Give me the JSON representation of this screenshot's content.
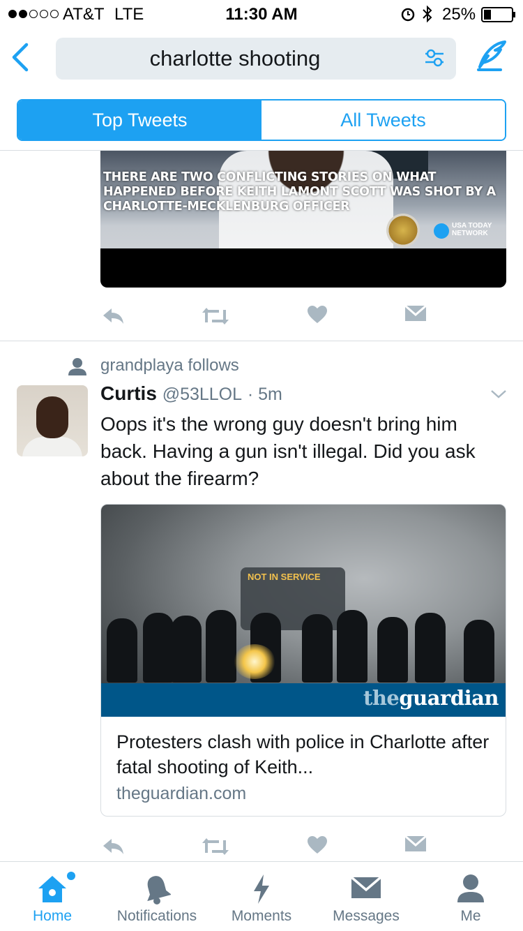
{
  "status_bar": {
    "carrier": "AT&T",
    "network": "LTE",
    "time": "11:30 AM",
    "battery": "25%"
  },
  "search": {
    "query": "charlotte shooting"
  },
  "tabs": [
    {
      "label": "Top Tweets",
      "active": true
    },
    {
      "label": "All Tweets",
      "active": false
    }
  ],
  "previous_tweet": {
    "video_caption": "THERE ARE TWO CONFLICTING STORIES ON WHAT HAPPENED BEFORE KEITH LAMONT SCOTT WAS SHOT BY A CHARLOTTE-MECKLENBURG OFFICER",
    "video_source": "USA TODAY NETWORK"
  },
  "tweet": {
    "social_context": "grandplaya follows",
    "display_name": "Curtis",
    "handle": "@53LLOL",
    "time": "· 5m",
    "text": "Oops it's the wrong guy doesn't bring him back. Having a gun isn't illegal. Did you ask about the firearm?",
    "card": {
      "image_sign": "NOT IN SERVICE",
      "logo_the": "the",
      "logo_guardian": "guardian",
      "title": "Protesters clash with police in Charlotte after fatal shooting of Keith...",
      "domain": "theguardian.com"
    }
  },
  "tab_bar": [
    {
      "label": "Home",
      "icon": "home-icon",
      "active": true
    },
    {
      "label": "Notifications",
      "icon": "bell-icon",
      "active": false
    },
    {
      "label": "Moments",
      "icon": "lightning-icon",
      "active": false
    },
    {
      "label": "Messages",
      "icon": "envelope-icon",
      "active": false
    },
    {
      "label": "Me",
      "icon": "person-icon",
      "active": false
    }
  ],
  "colors": {
    "accent": "#1da1f2",
    "secondary_text": "#657786",
    "icon_gray": "#aab8c2",
    "guardian_blue": "#005689"
  }
}
